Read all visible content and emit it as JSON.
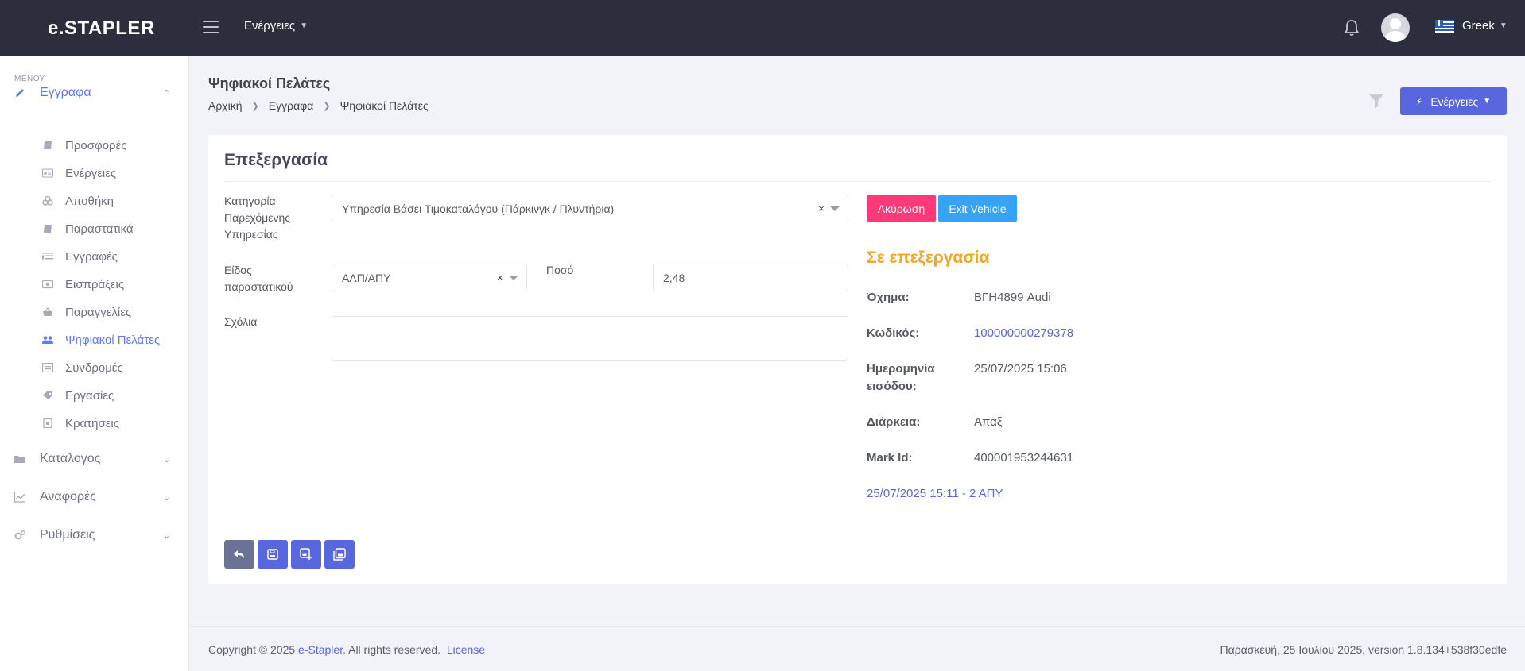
{
  "app": {
    "logo": "e.STAPLER"
  },
  "topbar": {
    "menu_label": "Ενέργειες",
    "language": "Greek"
  },
  "sidebar": {
    "menu_label": "ΜΕΝΟΥ",
    "sections": [
      {
        "label": "Εγγραφα",
        "icon": "pen-icon",
        "expanded": true
      },
      {
        "label": "Κατάλογος",
        "icon": "folder-icon",
        "expanded": false
      },
      {
        "label": "Αναφορές",
        "icon": "chart-line-icon",
        "expanded": false
      },
      {
        "label": "Ρυθμίσεις",
        "icon": "cogs-icon",
        "expanded": false
      }
    ],
    "items": [
      {
        "label": "Προσφορές",
        "icon": "book-icon"
      },
      {
        "label": "Ενέργειες",
        "icon": "id-card-icon"
      },
      {
        "label": "Αποθήκη",
        "icon": "boxes-icon"
      },
      {
        "label": "Παραστατικά",
        "icon": "book-icon"
      },
      {
        "label": "Εγγραφές",
        "icon": "list-icon"
      },
      {
        "label": "Εισπράξεις",
        "icon": "money-icon"
      },
      {
        "label": "Παραγγελίες",
        "icon": "basket-icon"
      },
      {
        "label": "Ψηφιακοί Πελάτες",
        "icon": "users-icon",
        "active": true
      },
      {
        "label": "Συνδρομές",
        "icon": "list-alt-icon"
      },
      {
        "label": "Εργασίες",
        "icon": "tag-icon"
      },
      {
        "label": "Κρατήσεις",
        "icon": "calendar-icon"
      }
    ]
  },
  "subheader": {
    "title": "Ψηφιακοί Πελάτες",
    "breadcrumb": [
      "Αρχική",
      "Εγγραφα",
      "Ψηφιακοί Πελάτες"
    ],
    "actions_label": "Ενέργειες"
  },
  "form": {
    "title": "Επεξεργασία",
    "category_label_lines": [
      "Κατηγορία",
      "Παρεχόμενης",
      "Υπηρεσίας"
    ],
    "category_value": "Υπηρεσία Βάσει Τιμοκαταλόγου (Πάρκινγκ / Πλυντήρια)",
    "doc_type_label_lines": [
      "Είδος",
      "παραστατικού"
    ],
    "doc_type_value": "ΑΛΠ/ΑΠΥ",
    "amount_label": "Ποσό",
    "amount_value": "2,48",
    "comments_label": "Σχόλια",
    "comments_value": "",
    "clear_symbol": "×"
  },
  "details": {
    "cancel_label": "Ακύρωση",
    "exit_label": "Exit Vehicle",
    "status": "Σε επεξεργασία",
    "vehicle_label": "Όχημα:",
    "vehicle_value": "ΒΓΗ4899 Audi",
    "code_label": "Κωδικός:",
    "code_value": "100000000279378",
    "entry_label_lines": [
      "Ημερομηνία",
      "εισόδου:"
    ],
    "entry_value": "25/07/2025 15:06",
    "duration_label": "Διάρκεια:",
    "duration_value": "Απαξ",
    "mark_label": "Mark Id:",
    "mark_value": "400001953244631",
    "receipt_link": "25/07/2025 15:11 - 2 ΑΠΥ"
  },
  "toolbar": {
    "buttons": [
      "back-icon",
      "save-icon",
      "save-new-icon",
      "save-copy-icon"
    ]
  },
  "footer": {
    "copyright_prefix": "Copyright © 2025",
    "brand": "e-Stapler.",
    "rights": "All rights reserved.",
    "license": "License",
    "version_text": "Παρασκευή, 25 Ιουλίου 2025, version 1.8.134+538f30edfe"
  },
  "colors": {
    "topbar": "#2c2e3e",
    "accent": "#5867dd",
    "danger": "#fd397a",
    "info": "#36a3f7",
    "warning": "#f5a623",
    "active_link": "#5d78ff"
  }
}
